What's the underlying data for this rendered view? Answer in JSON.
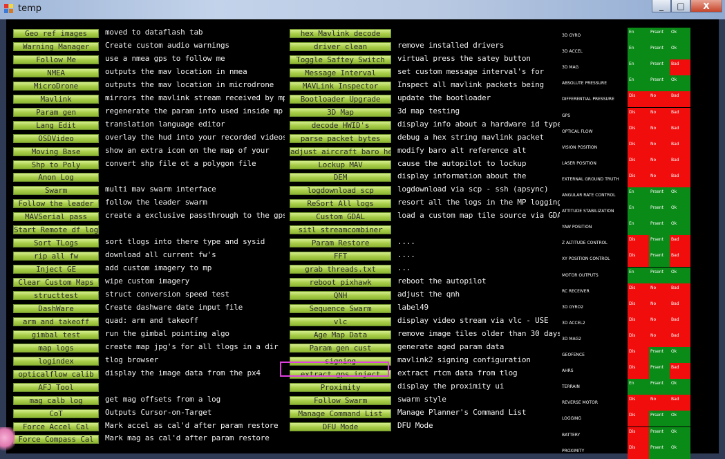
{
  "window": {
    "title": "temp",
    "minimize": "_",
    "maximize": "□",
    "close": "X"
  },
  "buttons": [
    {
      "label": "Geo ref images",
      "col": 0,
      "row": 0
    },
    {
      "label": "Warning Manager",
      "col": 0,
      "row": 1
    },
    {
      "label": "Follow Me",
      "col": 0,
      "row": 2
    },
    {
      "label": "NMEA",
      "col": 0,
      "row": 3
    },
    {
      "label": "MicroDrone",
      "col": 0,
      "row": 4
    },
    {
      "label": "Mavlink",
      "col": 0,
      "row": 5
    },
    {
      "label": "Param gen",
      "col": 0,
      "row": 6
    },
    {
      "label": "Lang Edit",
      "col": 0,
      "row": 7
    },
    {
      "label": "OSDVideo",
      "col": 0,
      "row": 8
    },
    {
      "label": "Moving Base",
      "col": 0,
      "row": 9
    },
    {
      "label": "Shp to Poly",
      "col": 0,
      "row": 10
    },
    {
      "label": "Anon Log",
      "col": 0,
      "row": 11
    },
    {
      "label": "Swarm",
      "col": 0,
      "row": 12
    },
    {
      "label": "Follow the leader",
      "col": 0,
      "row": 13
    },
    {
      "label": "MAVSerial pass",
      "col": 0,
      "row": 14
    },
    {
      "label": "Start Remote df log",
      "col": 0,
      "row": 15
    },
    {
      "label": "Sort TLogs",
      "col": 0,
      "row": 16
    },
    {
      "label": "rip all fw",
      "col": 0,
      "row": 17
    },
    {
      "label": "Inject GE",
      "col": 0,
      "row": 18
    },
    {
      "label": "Clear Custom Maps",
      "col": 0,
      "row": 19
    },
    {
      "label": "structtest",
      "col": 0,
      "row": 20
    },
    {
      "label": "DashWare",
      "col": 0,
      "row": 21
    },
    {
      "label": "arm and takeoff",
      "col": 0,
      "row": 22
    },
    {
      "label": "gimbal test",
      "col": 0,
      "row": 23
    },
    {
      "label": "map logs",
      "col": 0,
      "row": 24
    },
    {
      "label": "logindex",
      "col": 0,
      "row": 25
    },
    {
      "label": "opticalflow calib",
      "col": 0,
      "row": 26
    },
    {
      "label": "AFJ Tool",
      "col": 0,
      "row": 27
    },
    {
      "label": "mag calb log",
      "col": 0,
      "row": 28
    },
    {
      "label": "CoT",
      "col": 0,
      "row": 29
    },
    {
      "label": "Force Accel Cal",
      "col": 0,
      "row": 30
    },
    {
      "label": "Force Compass Cal",
      "col": 0,
      "row": 31
    },
    {
      "label": "hex Mavlink decode",
      "col": 1,
      "row": 0
    },
    {
      "label": "driver clean",
      "col": 1,
      "row": 1
    },
    {
      "label": "Toggle Saftey Switch",
      "col": 1,
      "row": 2
    },
    {
      "label": "Message Interval",
      "col": 1,
      "row": 3
    },
    {
      "label": "MAVLink Inspector",
      "col": 1,
      "row": 4
    },
    {
      "label": "Bootloader Upgrade",
      "col": 1,
      "row": 5
    },
    {
      "label": "3D Map",
      "col": 1,
      "row": 6
    },
    {
      "label": "decode HWID's",
      "col": 1,
      "row": 7
    },
    {
      "label": "parse packet bytes",
      "col": 1,
      "row": 8
    },
    {
      "label": "adjust aircraft baro he",
      "col": 1,
      "row": 9
    },
    {
      "label": "Lockup MAV",
      "col": 1,
      "row": 10
    },
    {
      "label": "DEM",
      "col": 1,
      "row": 11
    },
    {
      "label": "logdownload scp",
      "col": 1,
      "row": 12
    },
    {
      "label": "ReSort All logs",
      "col": 1,
      "row": 13
    },
    {
      "label": "Custom GDAL",
      "col": 1,
      "row": 14
    },
    {
      "label": "sitl streamcombiner",
      "col": 1,
      "row": 15
    },
    {
      "label": "Param Restore",
      "col": 1,
      "row": 16
    },
    {
      "label": "FFT",
      "col": 1,
      "row": 17
    },
    {
      "label": "grab threads.txt",
      "col": 1,
      "row": 18
    },
    {
      "label": "reboot pixhawk",
      "col": 1,
      "row": 19
    },
    {
      "label": "QNH",
      "col": 1,
      "row": 20
    },
    {
      "label": "Sequence Swarm",
      "col": 1,
      "row": 21
    },
    {
      "label": "vlc",
      "col": 1,
      "row": 22
    },
    {
      "label": "Age Map Data",
      "col": 1,
      "row": 23
    },
    {
      "label": "Param gen cust",
      "col": 1,
      "row": 24
    },
    {
      "label": "signing",
      "col": 1,
      "row": 25
    },
    {
      "label": "extract gps_inject",
      "col": 1,
      "row": 26
    },
    {
      "label": "Proximity",
      "col": 1,
      "row": 27
    },
    {
      "label": "Follow Swarm",
      "col": 1,
      "row": 28
    },
    {
      "label": "Manage Command List",
      "col": 1,
      "row": 29
    },
    {
      "label": "DFU Mode",
      "col": 1,
      "row": 30
    }
  ],
  "labels": [
    {
      "text": "moved to dataflash tab",
      "col": 0,
      "row": 0
    },
    {
      "text": "Create custom audio warnings",
      "col": 0,
      "row": 1
    },
    {
      "text": "use a nmea gps to follow me",
      "col": 0,
      "row": 2
    },
    {
      "text": "outputs the mav location in nmea",
      "col": 0,
      "row": 3
    },
    {
      "text": "outputs the mav location in microdrone",
      "col": 0,
      "row": 4
    },
    {
      "text": "mirrors the mavlink stream received by mp",
      "col": 0,
      "row": 5
    },
    {
      "text": "regenerate the param info used inside mp",
      "col": 0,
      "row": 6
    },
    {
      "text": "translation language editor",
      "col": 0,
      "row": 7
    },
    {
      "text": "overlay the hud into your recorded videos",
      "col": 0,
      "row": 8
    },
    {
      "text": "show an extra icon on the map of your",
      "col": 0,
      "row": 9
    },
    {
      "text": "convert shp file ot a polygon file",
      "col": 0,
      "row": 10
    },
    {
      "text": "multi mav swarm interface",
      "col": 0,
      "row": 12
    },
    {
      "text": "follow the leader swarm",
      "col": 0,
      "row": 13
    },
    {
      "text": "create a exclusive passthrough to the gps",
      "col": 0,
      "row": 14
    },
    {
      "text": "sort tlogs into there type and sysid",
      "col": 0,
      "row": 16
    },
    {
      "text": "download all current fw's",
      "col": 0,
      "row": 17
    },
    {
      "text": "add custom imagery to mp",
      "col": 0,
      "row": 18
    },
    {
      "text": "wipe custom imagery",
      "col": 0,
      "row": 19
    },
    {
      "text": "struct conversion speed test",
      "col": 0,
      "row": 20
    },
    {
      "text": "Create dashware date input file",
      "col": 0,
      "row": 21
    },
    {
      "text": "quad: arm and takeoff",
      "col": 0,
      "row": 22
    },
    {
      "text": "run the gimbal pointing algo",
      "col": 0,
      "row": 23
    },
    {
      "text": "create map jpg's for all tlogs in a dir",
      "col": 0,
      "row": 24
    },
    {
      "text": "tlog browser",
      "col": 0,
      "row": 25
    },
    {
      "text": "display the image data from the px4",
      "col": 0,
      "row": 26
    },
    {
      "text": "get mag offsets from a log",
      "col": 0,
      "row": 28
    },
    {
      "text": "Outputs Cursor-on-Target",
      "col": 0,
      "row": 29
    },
    {
      "text": "Mark accel as cal'd after param restore",
      "col": 0,
      "row": 30
    },
    {
      "text": "Mark mag as cal'd after param restore",
      "col": 0,
      "row": 31
    },
    {
      "text": "remove installed drivers",
      "col": 1,
      "row": 1
    },
    {
      "text": "virtual press the satey button",
      "col": 1,
      "row": 2
    },
    {
      "text": "set custom message interval's for",
      "col": 1,
      "row": 3
    },
    {
      "text": "Inspect all mavlink packets being",
      "col": 1,
      "row": 4
    },
    {
      "text": "update the bootloader",
      "col": 1,
      "row": 5
    },
    {
      "text": "3d map testing",
      "col": 1,
      "row": 6
    },
    {
      "text": "display info about a hardware id typed",
      "col": 1,
      "row": 7
    },
    {
      "text": "debug a hex string mavlink packet",
      "col": 1,
      "row": 8
    },
    {
      "text": "modify baro alt reference alt",
      "col": 1,
      "row": 9
    },
    {
      "text": "cause the autopilot to lockup",
      "col": 1,
      "row": 10
    },
    {
      "text": "display information about the",
      "col": 1,
      "row": 11
    },
    {
      "text": "logdownload via scp - ssh (apsync)",
      "col": 1,
      "row": 12
    },
    {
      "text": "resort all the logs in the MP logging",
      "col": 1,
      "row": 13
    },
    {
      "text": "load a custom map tile source via GDAL",
      "col": 1,
      "row": 14
    },
    {
      "text": "....",
      "col": 1,
      "row": 16
    },
    {
      "text": "....",
      "col": 1,
      "row": 17
    },
    {
      "text": "...",
      "col": 1,
      "row": 18
    },
    {
      "text": "reboot the autopilot",
      "col": 1,
      "row": 19
    },
    {
      "text": "adjust the qnh",
      "col": 1,
      "row": 20
    },
    {
      "text": "label49",
      "col": 1,
      "row": 21
    },
    {
      "text": "display video stream via vlc - USE",
      "col": 1,
      "row": 22
    },
    {
      "text": "remove image tiles older than 30 days",
      "col": 1,
      "row": 23
    },
    {
      "text": "generate aged param data",
      "col": 1,
      "row": 24
    },
    {
      "text": "mavlink2 signing configuration",
      "col": 1,
      "row": 25
    },
    {
      "text": "extract rtcm data from tlog",
      "col": 1,
      "row": 26
    },
    {
      "text": "display the proximity ui",
      "col": 1,
      "row": 27
    },
    {
      "text": "swarm style",
      "col": 1,
      "row": 28
    },
    {
      "text": "Manage Planner's Command List",
      "col": 1,
      "row": 29
    },
    {
      "text": "DFU Mode",
      "col": 1,
      "row": 30
    }
  ],
  "sensors": [
    {
      "name": "3D GYRO",
      "c1": "En",
      "c2": "Prsent",
      "c3": "Ok",
      "s": [
        "g",
        "g",
        "g"
      ]
    },
    {
      "name": "3D ACCEL",
      "c1": "En",
      "c2": "Prsent",
      "c3": "Ok",
      "s": [
        "g",
        "g",
        "g"
      ]
    },
    {
      "name": "3D MAG",
      "c1": "En",
      "c2": "Prsent",
      "c3": "Bad",
      "s": [
        "g",
        "g",
        "r"
      ]
    },
    {
      "name": "ABSOLUTE PRESSURE",
      "c1": "En",
      "c2": "Prsent",
      "c3": "Ok",
      "s": [
        "g",
        "g",
        "g"
      ]
    },
    {
      "name": "DIFFERENTIAL PRESSURE",
      "c1": "Dis",
      "c2": "No",
      "c3": "Bad",
      "s": [
        "r",
        "r",
        "r"
      ]
    },
    {
      "name": "GPS",
      "c1": "Dis",
      "c2": "No",
      "c3": "Bad",
      "s": [
        "r",
        "r",
        "r"
      ]
    },
    {
      "name": "OPTICAL FLOW",
      "c1": "Dis",
      "c2": "No",
      "c3": "Bad",
      "s": [
        "r",
        "r",
        "r"
      ]
    },
    {
      "name": "VISION POSITION",
      "c1": "Dis",
      "c2": "No",
      "c3": "Bad",
      "s": [
        "r",
        "r",
        "r"
      ]
    },
    {
      "name": "LASER POSITION",
      "c1": "Dis",
      "c2": "No",
      "c3": "Bad",
      "s": [
        "r",
        "r",
        "r"
      ]
    },
    {
      "name": "EXTERNAL GROUND TRUTH",
      "c1": "Dis",
      "c2": "No",
      "c3": "Bad",
      "s": [
        "r",
        "r",
        "r"
      ]
    },
    {
      "name": "ANGULAR RATE CONTROL",
      "c1": "En",
      "c2": "Prsent",
      "c3": "Ok",
      "s": [
        "g",
        "g",
        "g"
      ]
    },
    {
      "name": "ATTITUDE STABILIZATION",
      "c1": "En",
      "c2": "Prsent",
      "c3": "Ok",
      "s": [
        "g",
        "g",
        "g"
      ]
    },
    {
      "name": "YAW POSITION",
      "c1": "En",
      "c2": "Prsent",
      "c3": "Ok",
      "s": [
        "g",
        "g",
        "g"
      ]
    },
    {
      "name": "Z ALTITUDE CONTROL",
      "c1": "Dis",
      "c2": "Prsent",
      "c3": "Bad",
      "s": [
        "r",
        "g",
        "r"
      ]
    },
    {
      "name": "XY POSITION CONTROL",
      "c1": "Dis",
      "c2": "Prsent",
      "c3": "Bad",
      "s": [
        "r",
        "g",
        "r"
      ]
    },
    {
      "name": "MOTOR OUTPUTS",
      "c1": "En",
      "c2": "Prsent",
      "c3": "Ok",
      "s": [
        "g",
        "g",
        "g"
      ]
    },
    {
      "name": "RC RECEIVER",
      "c1": "Dis",
      "c2": "No",
      "c3": "Bad",
      "s": [
        "r",
        "r",
        "r"
      ]
    },
    {
      "name": "3D GYRO2",
      "c1": "Dis",
      "c2": "No",
      "c3": "Bad",
      "s": [
        "r",
        "r",
        "r"
      ]
    },
    {
      "name": "3D ACCEL2",
      "c1": "Dis",
      "c2": "No",
      "c3": "Bad",
      "s": [
        "r",
        "r",
        "r"
      ]
    },
    {
      "name": "3D MAG2",
      "c1": "Dis",
      "c2": "No",
      "c3": "Bad",
      "s": [
        "r",
        "r",
        "r"
      ]
    },
    {
      "name": "GEOFENCE",
      "c1": "Dis",
      "c2": "Prsent",
      "c3": "Ok",
      "s": [
        "r",
        "g",
        "g"
      ]
    },
    {
      "name": "AHRS",
      "c1": "Dis",
      "c2": "Prsent",
      "c3": "Bad",
      "s": [
        "r",
        "g",
        "r"
      ]
    },
    {
      "name": "TERRAIN",
      "c1": "En",
      "c2": "Prsent",
      "c3": "Ok",
      "s": [
        "g",
        "g",
        "g"
      ]
    },
    {
      "name": "REVERSE MOTOR",
      "c1": "Dis",
      "c2": "No",
      "c3": "Bad",
      "s": [
        "r",
        "r",
        "r"
      ]
    },
    {
      "name": "LOGGING",
      "c1": "Dis",
      "c2": "Prsent",
      "c3": "Ok",
      "s": [
        "r",
        "g",
        "g"
      ]
    },
    {
      "name": "BATTERY",
      "c1": "Dis",
      "c2": "Prsent",
      "c3": "Ok",
      "s": [
        "r",
        "g",
        "g"
      ]
    },
    {
      "name": "PROXIMITY",
      "c1": "Dis",
      "c2": "Prsent",
      "c3": "Ok",
      "s": [
        "r",
        "g",
        "g"
      ]
    }
  ],
  "highlighted_button": "Proximity"
}
